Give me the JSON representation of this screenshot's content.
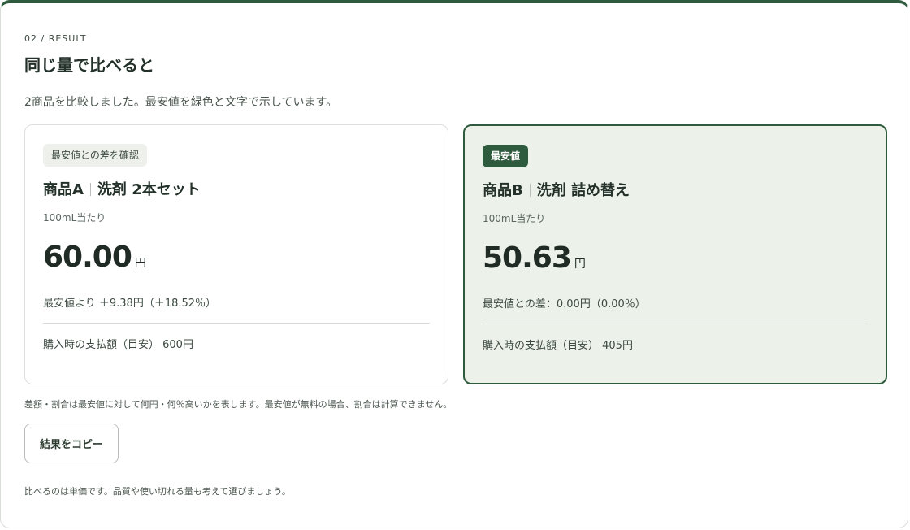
{
  "section": {
    "eyebrow": "02 / RESULT",
    "title": "同じ量で比べると",
    "intro": "2商品を比較しました。最安値を緑色と文字で示しています。"
  },
  "cards": [
    {
      "badge": "最安値との差を確認",
      "name": "商品A",
      "detail": "洗剤 2本セット",
      "per_unit_label": "100mL当たり",
      "price": "60.00",
      "currency": "円",
      "diff": "最安値より ＋9.38円（＋18.52％）",
      "total": "購入時の支払額（目安） 600円",
      "cheapest": false
    },
    {
      "badge": "最安値",
      "name": "商品B",
      "detail": "洗剤 詰め替え",
      "per_unit_label": "100mL当たり",
      "price": "50.63",
      "currency": "円",
      "diff": "最安値との差：0.00円（0.00％）",
      "total": "購入時の支払額（目安） 405円",
      "cheapest": true
    }
  ],
  "note": "差額・割合は最安値に対して何円・何％高いかを表します。最安値が無料の場合、割合は計算できません。",
  "copy_button": "結果をコピー",
  "footer": "比べるのは単価です。品質や使い切れる量も考えて選びましょう。",
  "colors": {
    "accent": "#2e5a3d",
    "cheapest_bg": "#ecf1e9"
  }
}
